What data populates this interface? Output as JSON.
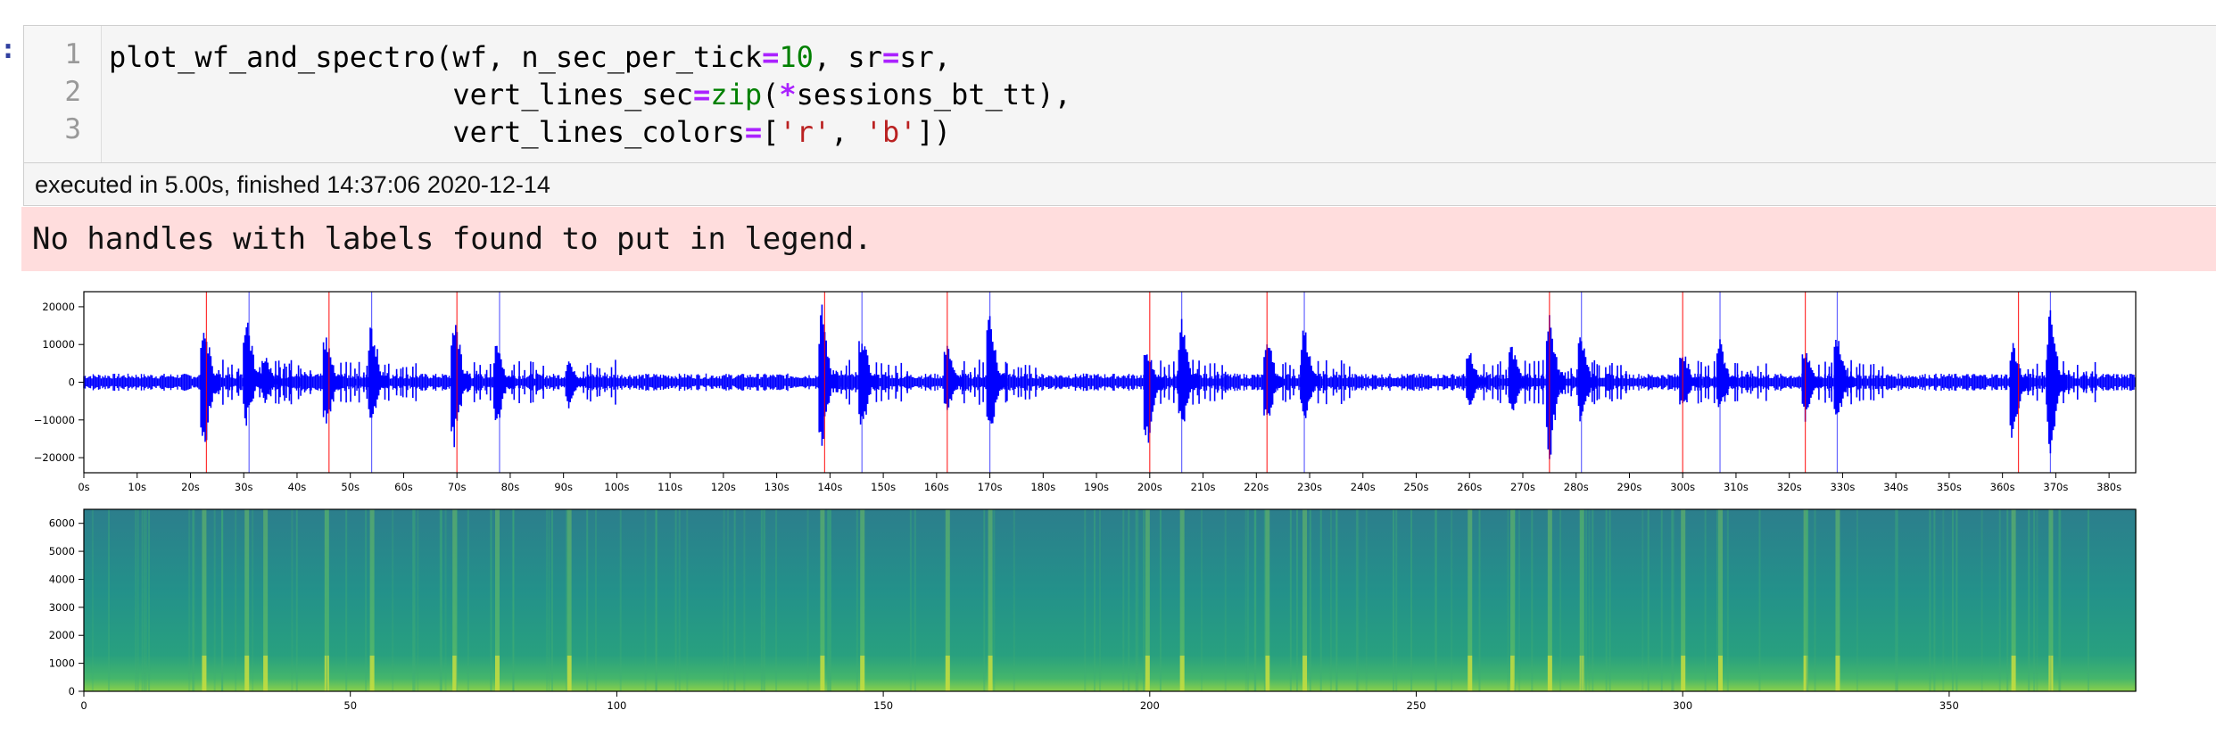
{
  "cell": {
    "prompt": ":",
    "line_numbers": [
      "1",
      "2",
      "3"
    ],
    "code_lines": [
      [
        {
          "t": "plot_wf_and_spectro(wf, n_sec_per_tick",
          "c": ""
        },
        {
          "t": "=",
          "c": "op"
        },
        {
          "t": "10",
          "c": "num"
        },
        {
          "t": ", sr",
          "c": ""
        },
        {
          "t": "=",
          "c": "op"
        },
        {
          "t": "sr,",
          "c": ""
        }
      ],
      [
        {
          "t": "                    vert_lines_sec",
          "c": ""
        },
        {
          "t": "=",
          "c": "op"
        },
        {
          "t": "zip",
          "c": "bi"
        },
        {
          "t": "(",
          "c": ""
        },
        {
          "t": "*",
          "c": "op"
        },
        {
          "t": "sessions_bt_tt),",
          "c": ""
        }
      ],
      [
        {
          "t": "                    vert_lines_colors",
          "c": ""
        },
        {
          "t": "=",
          "c": "op"
        },
        {
          "t": "[",
          "c": ""
        },
        {
          "t": "'r'",
          "c": "str"
        },
        {
          "t": ", ",
          "c": ""
        },
        {
          "t": "'b'",
          "c": "str"
        },
        {
          "t": "])",
          "c": ""
        }
      ]
    ],
    "execution_info": "executed in 5.00s, finished 14:37:06 2020-12-14",
    "stderr": "No handles with labels found to put in legend."
  },
  "colors": {
    "waveform": "#0000ff",
    "red_line": "#ff0000",
    "blue_line": "#0000ff"
  },
  "chart_data": [
    {
      "type": "line",
      "title": "",
      "xlabel": "",
      "ylabel": "",
      "xlim": [
        0,
        385
      ],
      "ylim": [
        -24000,
        24000
      ],
      "x_ticks": [
        0,
        10,
        20,
        30,
        40,
        50,
        60,
        70,
        80,
        90,
        100,
        110,
        120,
        130,
        140,
        150,
        160,
        170,
        180,
        190,
        200,
        210,
        220,
        230,
        240,
        250,
        260,
        270,
        280,
        290,
        300,
        310,
        320,
        330,
        340,
        350,
        360,
        370,
        380
      ],
      "x_tick_labels": [
        "0s",
        "10s",
        "20s",
        "30s",
        "40s",
        "50s",
        "60s",
        "70s",
        "80s",
        "90s",
        "100s",
        "110s",
        "120s",
        "130s",
        "140s",
        "150s",
        "160s",
        "170s",
        "180s",
        "190s",
        "200s",
        "210s",
        "220s",
        "230s",
        "240s",
        "250s",
        "260s",
        "270s",
        "280s",
        "290s",
        "300s",
        "310s",
        "320s",
        "330s",
        "340s",
        "350s",
        "360s",
        "370s",
        "380s"
      ],
      "y_ticks": [
        20000,
        10000,
        0,
        -10000,
        -20000
      ],
      "y_tick_labels": [
        "20000",
        "10000",
        "0",
        "−10000",
        "−20000"
      ],
      "vert_lines_red_sec": [
        23,
        46,
        70,
        139,
        162,
        200,
        222,
        275,
        300,
        323,
        363
      ],
      "vert_lines_blue_sec": [
        31,
        54,
        78,
        146,
        170,
        206,
        229,
        281,
        307,
        329,
        369
      ],
      "bursts": [
        {
          "t": 22.5,
          "peak": 19000,
          "trough": -21000
        },
        {
          "t": 30.5,
          "peak": 21000,
          "trough": -12000
        },
        {
          "t": 34,
          "peak": 8000,
          "trough": -6000
        },
        {
          "t": 45.5,
          "peak": 15000,
          "trough": -14000
        },
        {
          "t": 54,
          "peak": 18000,
          "trough": -12000
        },
        {
          "t": 69.5,
          "peak": 20000,
          "trough": -18000
        },
        {
          "t": 77.5,
          "peak": 11000,
          "trough": -13000
        },
        {
          "t": 91,
          "peak": 6000,
          "trough": -7000
        },
        {
          "t": 138.5,
          "peak": 22000,
          "trough": -18000
        },
        {
          "t": 146,
          "peak": 15000,
          "trough": -14000
        },
        {
          "t": 162,
          "peak": 12000,
          "trough": -8000
        },
        {
          "t": 170,
          "peak": 19000,
          "trough": -15000
        },
        {
          "t": 199.5,
          "peak": 10000,
          "trough": -19000
        },
        {
          "t": 206,
          "peak": 17000,
          "trough": -14000
        },
        {
          "t": 222,
          "peak": 14000,
          "trough": -12000
        },
        {
          "t": 229,
          "peak": 16000,
          "trough": -11000
        },
        {
          "t": 260,
          "peak": 9000,
          "trough": -7000
        },
        {
          "t": 268,
          "peak": 11000,
          "trough": -9000
        },
        {
          "t": 275,
          "peak": 19000,
          "trough": -22000
        },
        {
          "t": 281,
          "peak": 14000,
          "trough": -12000
        },
        {
          "t": 300,
          "peak": 10000,
          "trough": -9000
        },
        {
          "t": 307,
          "peak": 12000,
          "trough": -8000
        },
        {
          "t": 323,
          "peak": 10000,
          "trough": -12000
        },
        {
          "t": 329,
          "peak": 14000,
          "trough": -11000
        },
        {
          "t": 362,
          "peak": 11000,
          "trough": -17000
        },
        {
          "t": 369,
          "peak": 20000,
          "trough": -19000
        }
      ]
    },
    {
      "type": "heatmap",
      "title": "",
      "xlabel": "",
      "ylabel": "",
      "xlim": [
        0,
        385
      ],
      "ylim": [
        0,
        6500
      ],
      "x_ticks": [
        0,
        50,
        100,
        150,
        200,
        250,
        300,
        350
      ],
      "x_tick_labels": [
        "0",
        "50",
        "100",
        "150",
        "200",
        "250",
        "300",
        "350"
      ],
      "y_ticks": [
        0,
        1000,
        2000,
        3000,
        4000,
        5000,
        6000
      ],
      "y_tick_labels": [
        "0",
        "1000",
        "2000",
        "3000",
        "4000",
        "5000",
        "6000"
      ],
      "colormap": [
        "#440154",
        "#3b528b",
        "#21908d",
        "#5dc863",
        "#fde725"
      ]
    }
  ]
}
